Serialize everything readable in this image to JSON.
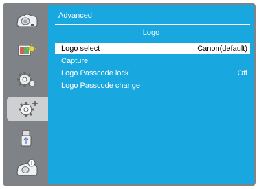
{
  "menu": {
    "header": "Advanced",
    "title": "Logo",
    "items": [
      {
        "label": "Logo select",
        "value": "Canon(default)"
      },
      {
        "label": "Capture",
        "value": ""
      },
      {
        "label": "Logo Passcode lock",
        "value": "Off"
      },
      {
        "label": "Logo Passcode change",
        "value": ""
      }
    ],
    "selected_index": 0
  },
  "sidebar": {
    "tabs": [
      "projector-icon",
      "image-adjust-icon",
      "settings-gear-icon",
      "advanced-settings-icon",
      "usb-icon",
      "info-icon"
    ],
    "active_index": 3
  },
  "colors": {
    "panel": "#18a8df",
    "frame": "#7f8286",
    "active_tab": "#cfd0d2"
  }
}
